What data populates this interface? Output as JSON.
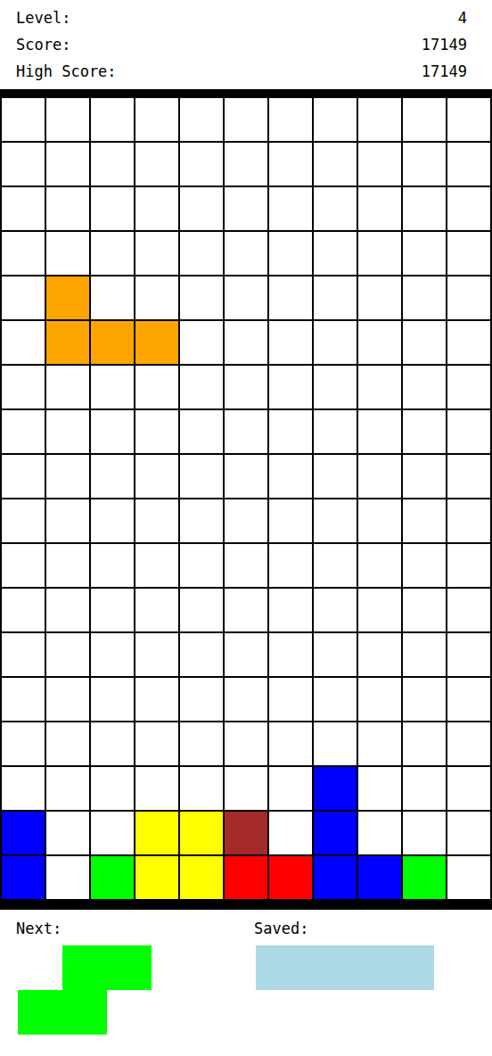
{
  "stats": [
    {
      "label": "Level:",
      "value": "4"
    },
    {
      "label": "Score:",
      "value": "17149"
    },
    {
      "label": "High Score:",
      "value": "17149"
    }
  ],
  "board": {
    "rows": [
      [
        null,
        null,
        null,
        null,
        null,
        null,
        null,
        null,
        null,
        null,
        null
      ],
      [
        null,
        null,
        null,
        null,
        null,
        null,
        null,
        null,
        null,
        null,
        null
      ],
      [
        null,
        null,
        null,
        null,
        null,
        null,
        null,
        null,
        null,
        null,
        null
      ],
      [
        null,
        null,
        null,
        null,
        null,
        null,
        null,
        null,
        null,
        null,
        null
      ],
      [
        null,
        "#ffa500",
        null,
        null,
        null,
        null,
        null,
        null,
        null,
        null,
        null
      ],
      [
        null,
        "#ffa500",
        "#ffa500",
        "#ffa500",
        null,
        null,
        null,
        null,
        null,
        null,
        null
      ],
      [
        null,
        null,
        null,
        null,
        null,
        null,
        null,
        null,
        null,
        null,
        null
      ],
      [
        null,
        null,
        null,
        null,
        null,
        null,
        null,
        null,
        null,
        null,
        null
      ],
      [
        null,
        null,
        null,
        null,
        null,
        null,
        null,
        null,
        null,
        null,
        null
      ],
      [
        null,
        null,
        null,
        null,
        null,
        null,
        null,
        null,
        null,
        null,
        null
      ],
      [
        null,
        null,
        null,
        null,
        null,
        null,
        null,
        null,
        null,
        null,
        null
      ],
      [
        null,
        null,
        null,
        null,
        null,
        null,
        null,
        null,
        null,
        null,
        null
      ],
      [
        null,
        null,
        null,
        null,
        null,
        null,
        null,
        null,
        null,
        null,
        null
      ],
      [
        null,
        null,
        null,
        null,
        null,
        null,
        null,
        null,
        null,
        null,
        null
      ],
      [
        null,
        null,
        null,
        null,
        null,
        null,
        null,
        null,
        null,
        null,
        null
      ],
      [
        null,
        null,
        null,
        null,
        null,
        null,
        null,
        "#0000ff",
        null,
        null,
        null
      ],
      [
        "#0000ff",
        null,
        null,
        "#ffff00",
        "#ffff00",
        "#a52a2a",
        null,
        "#0000ff",
        null,
        null,
        null
      ],
      [
        "#0000ff",
        null,
        "#00ff00",
        "#ffff00",
        "#ffff00",
        "#ff0000",
        "#ff0000",
        "#0000ff",
        "#0000ff",
        "#00ff00",
        null
      ]
    ]
  },
  "next": {
    "label": "Next:",
    "color": "#00ff00",
    "cells": [
      [
        0,
        1,
        1
      ],
      [
        1,
        1,
        0
      ]
    ]
  },
  "saved": {
    "label": "Saved:",
    "color": "#add8e6",
    "cells": [
      [
        1,
        1,
        1,
        1
      ]
    ]
  }
}
